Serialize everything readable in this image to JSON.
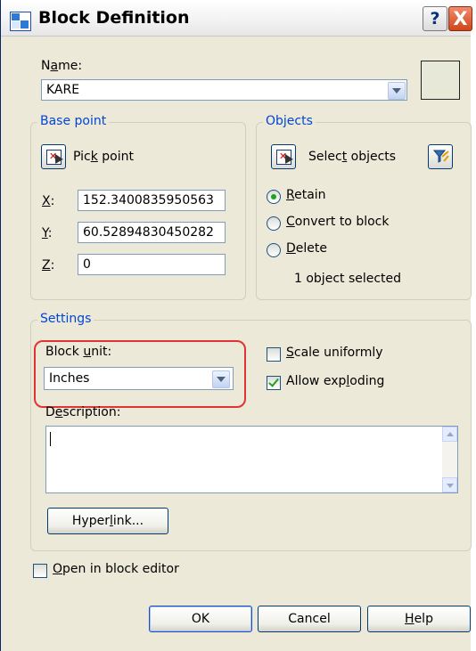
{
  "window": {
    "title": "Block Definition",
    "help_glyph": "?",
    "close_glyph": "X"
  },
  "name": {
    "label": "Name:",
    "value": "KARE"
  },
  "base_point": {
    "title": "Base point",
    "pick_label": "Pick point",
    "x_label": "X:",
    "x_value": "152.3400835950563",
    "y_label": "Y:",
    "y_value": "60.52894830450282",
    "z_label": "Z:",
    "z_value": "0"
  },
  "objects": {
    "title": "Objects",
    "select_label": "Select objects",
    "retain_label": "Retain",
    "convert_label": "Convert to block",
    "delete_label": "Delete",
    "status": "1 object selected",
    "selected_option": "Retain"
  },
  "settings": {
    "title": "Settings",
    "block_unit_label": "Block unit:",
    "block_unit_value": "Inches",
    "scale_uniformly_label": "Scale uniformly",
    "scale_uniformly_checked": false,
    "allow_exploding_label": "Allow exploding",
    "allow_exploding_checked": true,
    "description_label": "Description:",
    "description_value": "",
    "hyperlink_label": "Hyperlink..."
  },
  "open_in_block_editor": {
    "label": "Open in block editor",
    "checked": false
  },
  "buttons": {
    "ok": "OK",
    "cancel": "Cancel",
    "help": "Help"
  },
  "colors": {
    "highlight": "#e03434",
    "group_title": "#0046d5",
    "dialog_bg": "#ece9d8"
  }
}
